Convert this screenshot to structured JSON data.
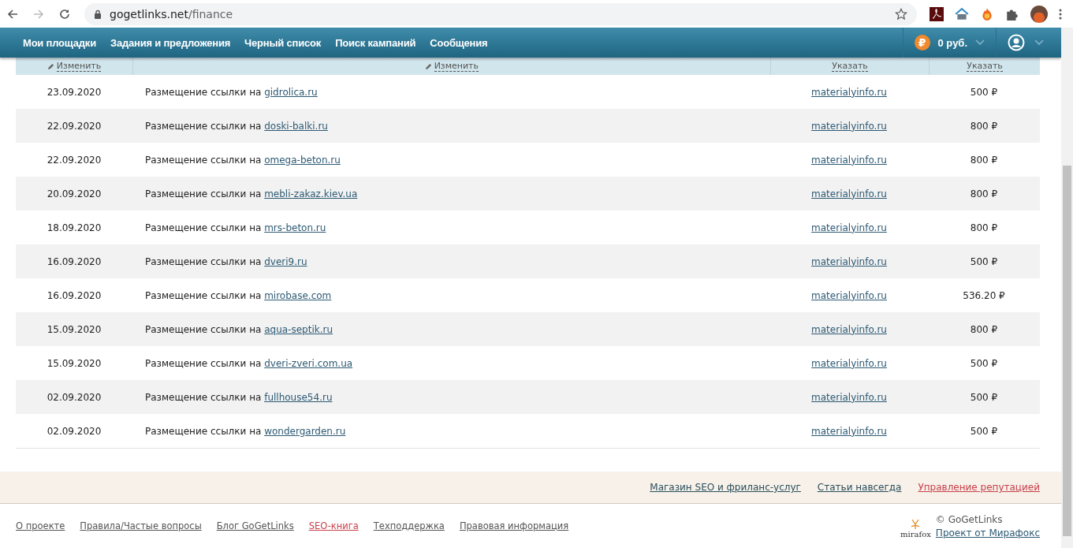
{
  "browser": {
    "url_host": "gogetlinks.net",
    "url_path": "/finance",
    "forward_disabled": true
  },
  "nav": {
    "items": [
      "Мои площадки",
      "Задания и предложения",
      "Черный список",
      "Поиск кампаний",
      "Сообщения"
    ],
    "balance_glyph": "₽",
    "balance": "0 руб."
  },
  "table": {
    "header_actions": [
      "Изменить",
      "Изменить",
      "Указать",
      "Указать"
    ],
    "rows": [
      {
        "date": "23.09.2020",
        "text": "Размещение ссылки на",
        "link": "gidrolica.ru",
        "site": "materialyinfo.ru",
        "amount": "500 ₽"
      },
      {
        "date": "22.09.2020",
        "text": "Размещение ссылки на",
        "link": "doski-balki.ru",
        "site": "materialyinfo.ru",
        "amount": "800 ₽"
      },
      {
        "date": "22.09.2020",
        "text": "Размещение ссылки на",
        "link": "omega-beton.ru",
        "site": "materialyinfo.ru",
        "amount": "800 ₽"
      },
      {
        "date": "20.09.2020",
        "text": "Размещение ссылки на",
        "link": "mebli-zakaz.kiev.ua",
        "site": "materialyinfo.ru",
        "amount": "800 ₽"
      },
      {
        "date": "18.09.2020",
        "text": "Размещение ссылки на",
        "link": "mrs-beton.ru",
        "site": "materialyinfo.ru",
        "amount": "800 ₽"
      },
      {
        "date": "16.09.2020",
        "text": "Размещение ссылки на",
        "link": "dveri9.ru",
        "site": "materialyinfo.ru",
        "amount": "500 ₽"
      },
      {
        "date": "16.09.2020",
        "text": "Размещение ссылки на",
        "link": "mirobase.com",
        "site": "materialyinfo.ru",
        "amount": "536.20 ₽"
      },
      {
        "date": "15.09.2020",
        "text": "Размещение ссылки на",
        "link": "aqua-septik.ru",
        "site": "materialyinfo.ru",
        "amount": "800 ₽"
      },
      {
        "date": "15.09.2020",
        "text": "Размещение ссылки на",
        "link": "dveri-zveri.com.ua",
        "site": "materialyinfo.ru",
        "amount": "500 ₽"
      },
      {
        "date": "02.09.2020",
        "text": "Размещение ссылки на",
        "link": "fullhouse54.ru",
        "site": "materialyinfo.ru",
        "amount": "500 ₽"
      },
      {
        "date": "02.09.2020",
        "text": "Размещение ссылки на",
        "link": "wondergarden.ru",
        "site": "materialyinfo.ru",
        "amount": "500 ₽"
      }
    ]
  },
  "promo_links": [
    {
      "label": "Магазин SEO и фриланс-услуг",
      "accent": false
    },
    {
      "label": "Статьи навсегда",
      "accent": false
    },
    {
      "label": "Управление репутацией",
      "accent": true
    }
  ],
  "footer_links": [
    {
      "label": "О проекте",
      "accent": false
    },
    {
      "label": "Правила/Частые вопросы",
      "accent": false
    },
    {
      "label": "Блог GoGetLinks",
      "accent": false
    },
    {
      "label": "SEO-книга",
      "accent": true
    },
    {
      "label": "Техподдержка",
      "accent": false
    },
    {
      "label": "Правовая информация",
      "accent": false
    }
  ],
  "copyright": {
    "logo_text": "mirafox",
    "text": "© GoGetLinks",
    "link": "Проект от Мирафокс"
  }
}
